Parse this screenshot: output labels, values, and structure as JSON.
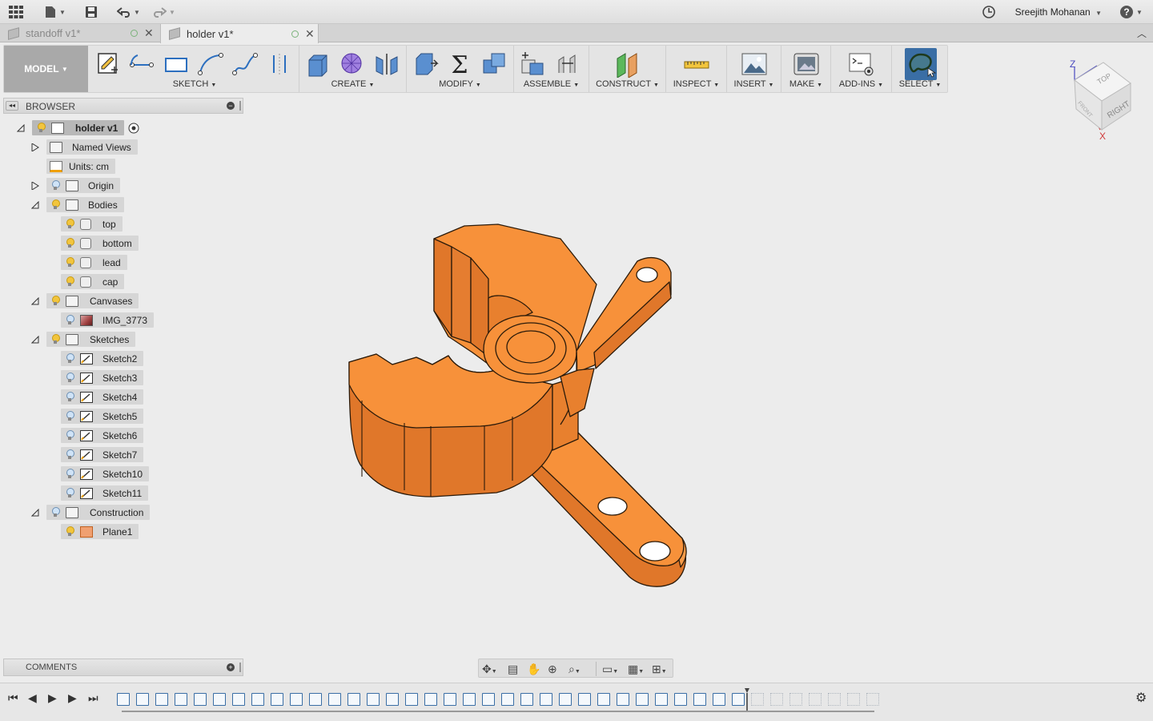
{
  "topbar": {
    "user_name": "Sreejith Mohanan",
    "icons": [
      "app-grid-icon",
      "file-menu-icon",
      "save-icon",
      "undo-icon",
      "redo-icon",
      "job-status-icon",
      "help-icon"
    ]
  },
  "tabs": [
    {
      "label": "standoff v1*",
      "active": false
    },
    {
      "label": "holder v1*",
      "active": true
    }
  ],
  "toolbar": {
    "workspace": "MODEL",
    "groups": [
      {
        "label": "SKETCH"
      },
      {
        "label": "CREATE"
      },
      {
        "label": "MODIFY"
      },
      {
        "label": "ASSEMBLE"
      },
      {
        "label": "CONSTRUCT"
      },
      {
        "label": "INSPECT"
      },
      {
        "label": "INSERT"
      },
      {
        "label": "MAKE"
      },
      {
        "label": "ADD-INS"
      },
      {
        "label": "SELECT"
      }
    ]
  },
  "browser": {
    "title": "BROWSER",
    "root": "holder v1",
    "named_views": "Named Views",
    "units": "Units: cm",
    "origin": "Origin",
    "bodies": {
      "label": "Bodies",
      "items": [
        "top",
        "bottom",
        "lead",
        "cap"
      ]
    },
    "canvases": {
      "label": "Canvases",
      "items": [
        "IMG_3773"
      ]
    },
    "sketches": {
      "label": "Sketches",
      "items": [
        "Sketch2",
        "Sketch3",
        "Sketch4",
        "Sketch5",
        "Sketch6",
        "Sketch7",
        "Sketch10",
        "Sketch11"
      ]
    },
    "construction": {
      "label": "Construction",
      "items": [
        "Plane1"
      ]
    }
  },
  "comments": {
    "title": "COMMENTS"
  },
  "viewcube": {
    "top": "TOP",
    "right": "RIGHT",
    "front": "FRONT",
    "axis_z": "Z",
    "axis_x": "X"
  },
  "colors": {
    "model_orange": "#f7913a",
    "edge": "#2a1a0a",
    "background": "#ececec",
    "select_accent": "#3a6ea5"
  }
}
